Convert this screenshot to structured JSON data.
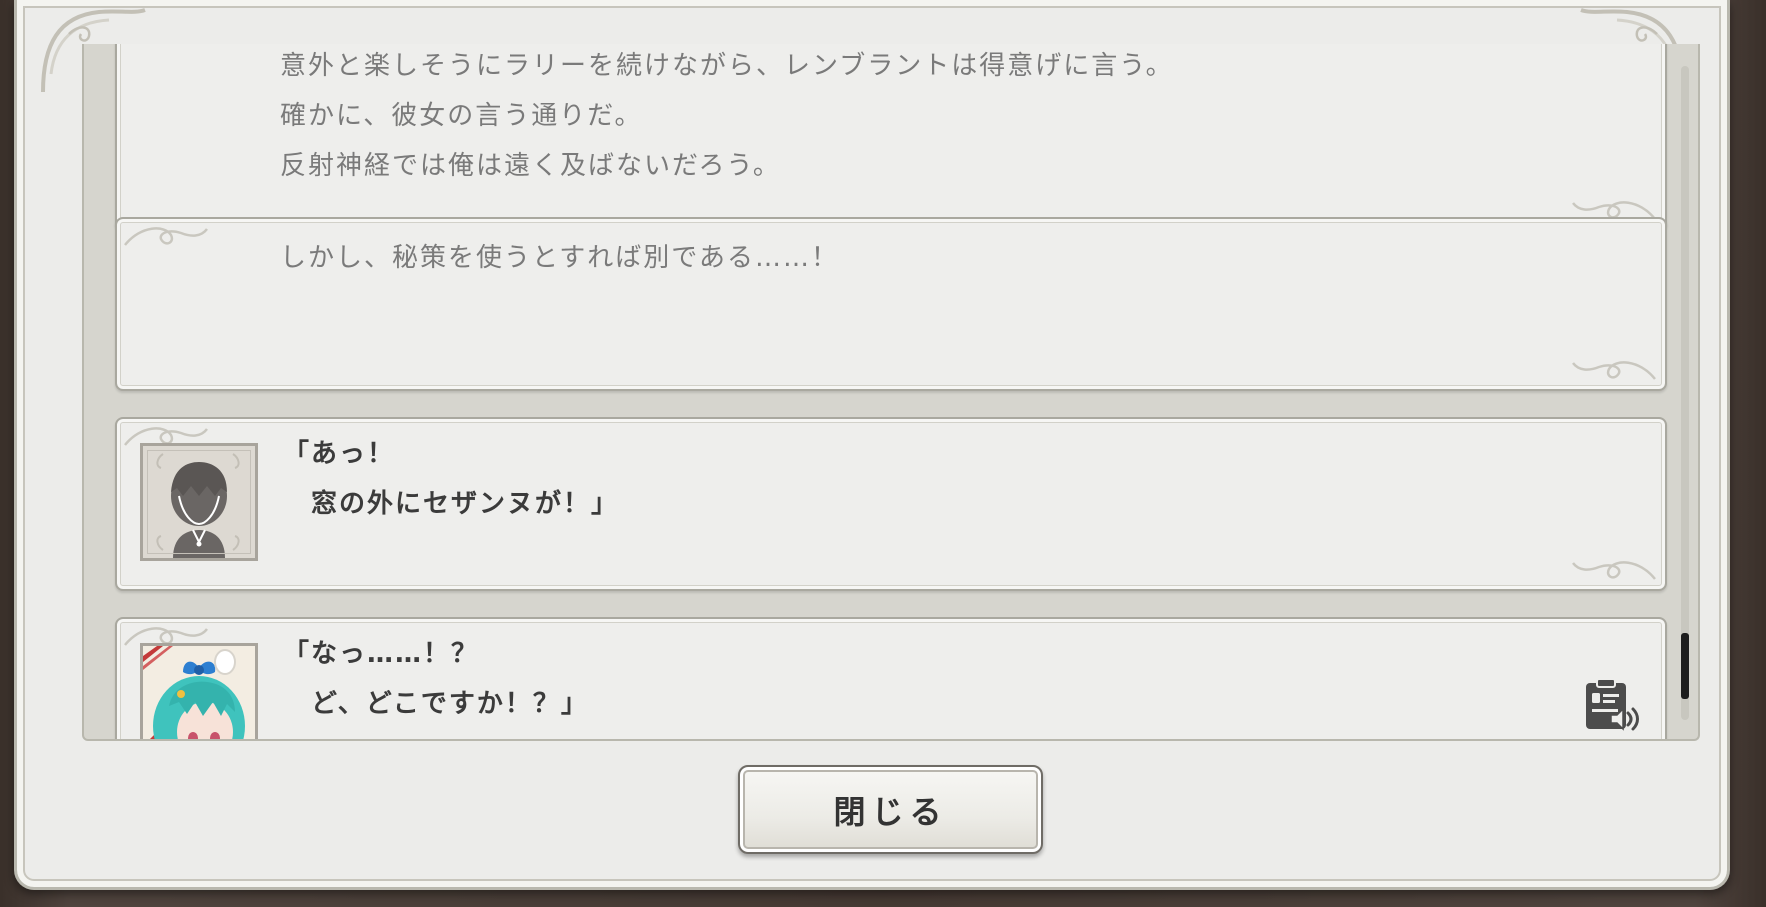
{
  "backlog": {
    "entries": [
      {
        "speaker": "",
        "lines": [
          "意外と楽しそうにラリーを続けながら、レンブラントは得意げに言う。",
          "確かに、彼女の言う通りだ。",
          "反射神経では俺は遠く及ばないだろう。"
        ]
      },
      {
        "speaker": "",
        "lines": [
          "しかし、秘策を使うとすれば別である……！"
        ]
      },
      {
        "speaker": "protagonist",
        "lines": [
          "「あっ！",
          "　窓の外にセザンヌが！」"
        ]
      },
      {
        "speaker": "teal-haired-girl",
        "lines": [
          "「なっ……！？",
          "　ど、どこですか！？」"
        ]
      }
    ],
    "voice_replay_icon": "voice-replay-icon"
  },
  "footer": {
    "close_label": "閉じる"
  },
  "colors": {
    "panel_bg": "#ececea",
    "entry_bg": "#eeeeec",
    "narration_text": "#7a7a7a",
    "dialogue_text": "#3b3b3b",
    "portrait_hair": "#3fc3bd",
    "portrait_bow": "#2d7fd1"
  }
}
